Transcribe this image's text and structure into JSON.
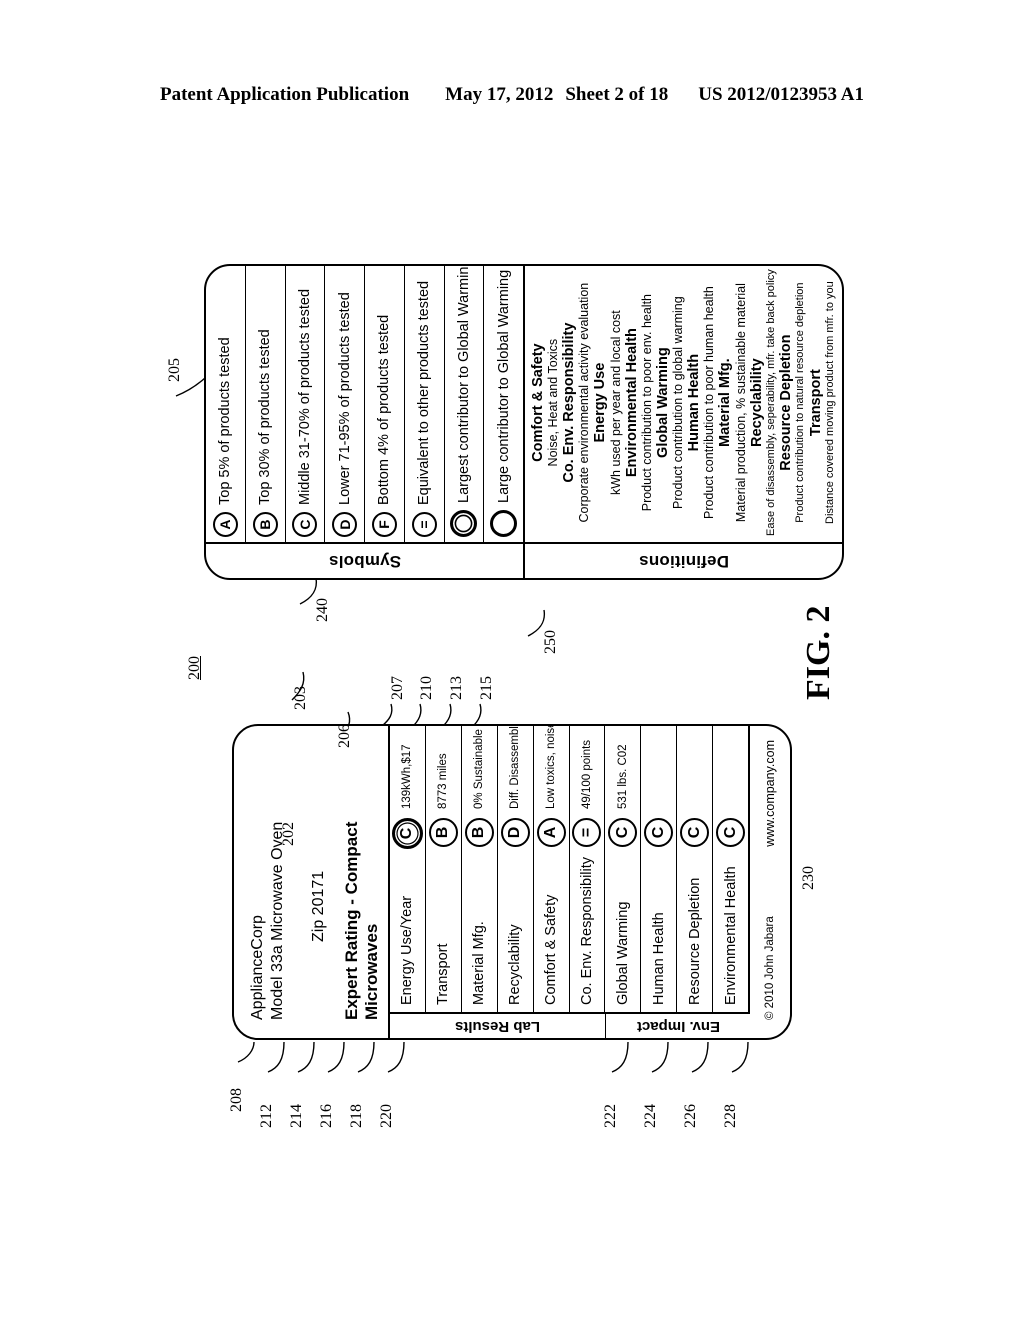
{
  "header": {
    "publication": "Patent Application Publication",
    "date": "May 17, 2012",
    "sheet": "Sheet 2 of 18",
    "number": "US 2012/0123953 A1"
  },
  "figure": {
    "label": "FIG. 2",
    "numerals": {
      "n200": "200",
      "n202": "202",
      "n203": "203",
      "n205": "205",
      "n206": "206",
      "n207": "207",
      "n208": "208",
      "n210": "210",
      "n212": "212",
      "n213": "213",
      "n214": "214",
      "n215": "215",
      "n216": "216",
      "n218": "218",
      "n220": "220",
      "n222": "222",
      "n224": "224",
      "n226": "226",
      "n228": "228",
      "n230": "230",
      "n240": "240",
      "n250": "250"
    }
  },
  "label_card": {
    "brand": "ApplianceCorp",
    "model": "Model 33a Microwave Oven",
    "zip": "Zip 20171",
    "rating_title": "Expert Rating - Compact Microwaves",
    "groups": [
      {
        "tag": "Lab Results"
      },
      {
        "tag": "Env. Impact"
      }
    ],
    "rows": [
      {
        "name": "Energy Use/Year",
        "grade": "C",
        "value": "139kWh,$17",
        "highlight": true,
        "group": "Lab Results"
      },
      {
        "name": "Transport",
        "grade": "B",
        "value": "8773 miles",
        "highlight": false,
        "group": "Lab Results"
      },
      {
        "name": "Material Mfg.",
        "grade": "B",
        "value": "0% Sustainable",
        "highlight": false,
        "group": "Lab Results"
      },
      {
        "name": "Recyclability",
        "grade": "D",
        "value": "Diff. Disassembly",
        "highlight": false,
        "group": "Lab Results"
      },
      {
        "name": "Comfort & Safety",
        "grade": "A",
        "value": "Low toxics, noise",
        "highlight": false,
        "group": "Lab Results"
      },
      {
        "name": "Co. Env. Responsibility",
        "grade": "=",
        "value": "49/100 points",
        "highlight": false,
        "group": "Lab Results"
      },
      {
        "name": "Global Warming",
        "grade": "C",
        "value": "531 lbs. C02",
        "highlight": false,
        "group": "Env. Impact"
      },
      {
        "name": "Human Health",
        "grade": "C",
        "value": "",
        "highlight": false,
        "group": "Env. Impact"
      },
      {
        "name": "Resource Depletion",
        "grade": "C",
        "value": "",
        "highlight": false,
        "group": "Env. Impact"
      },
      {
        "name": "Environmental Health",
        "grade": "C",
        "value": "",
        "highlight": false,
        "group": "Env. Impact"
      }
    ],
    "url": "www.company.com",
    "copyright": "© 2010 John Jabara"
  },
  "legend_card": {
    "symbols_title": "Symbols",
    "definitions_title": "Definitions",
    "symbols": [
      {
        "glyph": "A",
        "style": "letter",
        "text": "Top 5% of products tested"
      },
      {
        "glyph": "B",
        "style": "letter",
        "text": "Top 30% of products tested"
      },
      {
        "glyph": "C",
        "style": "letter",
        "text": "Middle 31-70% of products tested"
      },
      {
        "glyph": "D",
        "style": "letter",
        "text": "Lower 71-95% of products tested"
      },
      {
        "glyph": "F",
        "style": "letter",
        "text": "Bottom 4% of products tested"
      },
      {
        "glyph": "=",
        "style": "letter",
        "text": "Equivalent to other products tested"
      },
      {
        "glyph": "",
        "style": "ring2",
        "text": "Largest contributor to Global Warming"
      },
      {
        "glyph": "",
        "style": "ring",
        "text": "Large contributor to Global Warming"
      }
    ],
    "definitions": [
      {
        "head": "Comfort & Safety",
        "desc": "Noise, Heat and Toxics",
        "small": false
      },
      {
        "head": "Co. Env. Responsibility",
        "desc": "Corporate environmental activity evaluation",
        "small": false
      },
      {
        "head": "Energy Use",
        "desc": "kWh used per year and local cost",
        "small": false
      },
      {
        "head": "Environmental Health",
        "desc": "Product contribution to poor env. health",
        "small": false
      },
      {
        "head": "Global Warming",
        "desc": "Product contribution to global warming",
        "small": false
      },
      {
        "head": "Human Health",
        "desc": "Product contribution to poor human health",
        "small": false
      },
      {
        "head": "Material Mfg.",
        "desc": "Material production, % sustainable material",
        "small": false
      },
      {
        "head": "Recyclability",
        "desc": "Ease of disassembly, seperability, mfr. take back policy",
        "small": true
      },
      {
        "head": "Resource Depletion",
        "desc": "Product contribution to natural resource depletion",
        "small": true
      },
      {
        "head": "Transport",
        "desc": "Distance covered moving product from mfr. to you",
        "small": true
      }
    ]
  }
}
